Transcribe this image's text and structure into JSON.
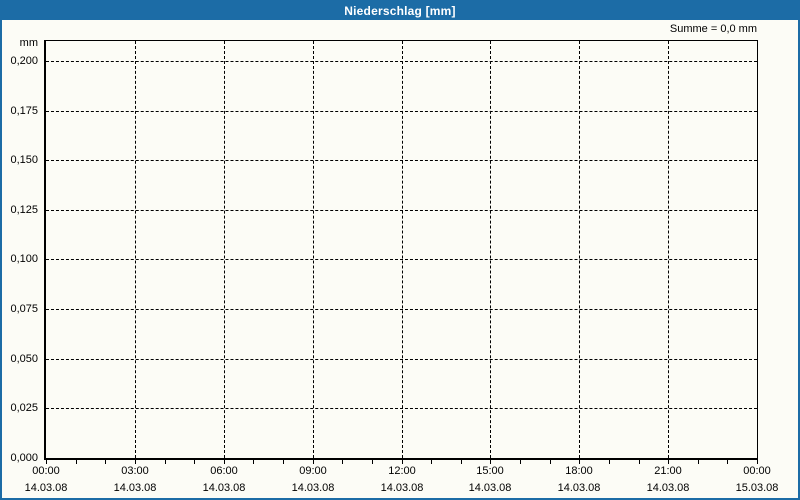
{
  "window": {
    "title": "Niederschlag [mm]"
  },
  "summary": {
    "text": "Summe = 0,0 mm"
  },
  "colors": {
    "titlebar_bg": "#1c6ca6",
    "window_border": "#1c6ca6",
    "title_text": "#ffffff",
    "background": "#fcfcf6",
    "grid_line": "#000000",
    "axis_line": "#000000",
    "text": "#000000"
  },
  "chart_data": {
    "type": "bar",
    "title": "Niederschlag [mm]",
    "xlabel": "",
    "ylabel": "mm",
    "ylim": [
      0,
      0.21
    ],
    "grid": "dashed",
    "legend_position": "none",
    "y_ticks": [
      {
        "value": 0.2,
        "label": "0,200"
      },
      {
        "value": 0.175,
        "label": "0,175"
      },
      {
        "value": 0.15,
        "label": "0,150"
      },
      {
        "value": 0.125,
        "label": "0,125"
      },
      {
        "value": 0.1,
        "label": "0,100"
      },
      {
        "value": 0.075,
        "label": "0,075"
      },
      {
        "value": 0.05,
        "label": "0,050"
      },
      {
        "value": 0.025,
        "label": "0,025"
      },
      {
        "value": 0.0,
        "label": "0,000"
      }
    ],
    "x_ticks": [
      {
        "time": "00:00",
        "date": "14.03.08"
      },
      {
        "time": "03:00",
        "date": "14.03.08"
      },
      {
        "time": "06:00",
        "date": "14.03.08"
      },
      {
        "time": "09:00",
        "date": "14.03.08"
      },
      {
        "time": "12:00",
        "date": "14.03.08"
      },
      {
        "time": "15:00",
        "date": "14.03.08"
      },
      {
        "time": "18:00",
        "date": "14.03.08"
      },
      {
        "time": "21:00",
        "date": "14.03.08"
      },
      {
        "time": "00:00",
        "date": "15.03.08"
      }
    ],
    "x_hours_total": 24,
    "x_minor_tick_interval_hours": 1,
    "x_major_tick_interval_hours": 3,
    "series": [
      {
        "name": "Niederschlag",
        "values": []
      }
    ],
    "total_mm": 0.0
  }
}
